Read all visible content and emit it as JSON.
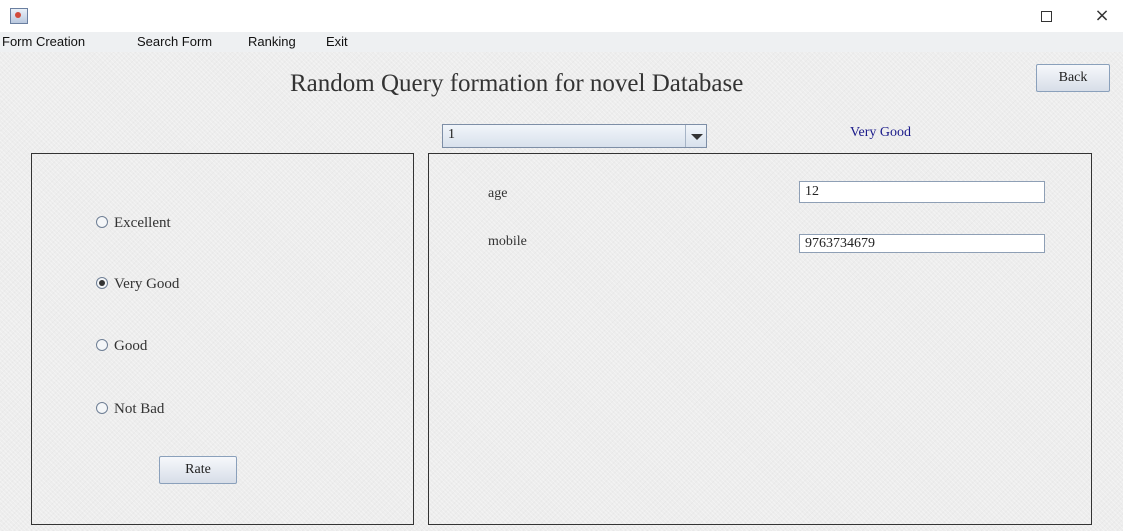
{
  "window": {
    "close_symbol": "×"
  },
  "menu": [
    "Form Creation",
    "Search Form",
    "Ranking",
    "Exit"
  ],
  "header": {
    "title": "Random Query formation for novel Database",
    "back_label": "Back"
  },
  "selector": {
    "selected": "1",
    "rating_text": "Very Good"
  },
  "rating": {
    "options": [
      {
        "label": "Excellent",
        "selected": false
      },
      {
        "label": "Very Good",
        "selected": true
      },
      {
        "label": "Good",
        "selected": false
      },
      {
        "label": "Not Bad",
        "selected": false
      }
    ],
    "rate_label": "Rate"
  },
  "form": {
    "fields": [
      {
        "label": "age",
        "value": "12"
      },
      {
        "label": "mobile",
        "value": "9763734679"
      }
    ]
  },
  "colors": {
    "rating_text": "#1a1a8a"
  }
}
